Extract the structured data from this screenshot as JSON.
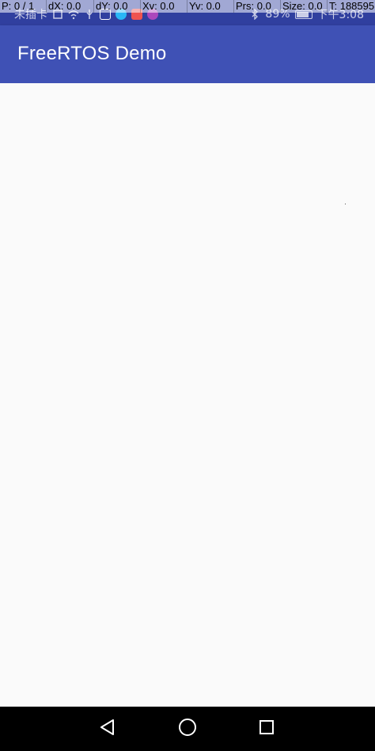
{
  "pointer_overlay": {
    "p": "P: 0 / 1",
    "dx": "dX: 0.0",
    "dy": "dY: 0.0",
    "xv": "Xv: 0.0",
    "yv": "Yv: 0.0",
    "prs": "Prs: 0.0",
    "size": "Size: 0.0",
    "t": "T: 188595"
  },
  "status_bar": {
    "carrier": "未插卡",
    "battery_percent": "89%",
    "time": "下午3:08",
    "app_icon_colors": [
      "#ffffff",
      "#29b6f6",
      "#ef5350",
      "#ab47bc"
    ]
  },
  "app_bar": {
    "title": "FreeRTOS Demo",
    "color": "#3f51b5"
  },
  "nav_bar": {
    "back_icon": "back-triangle-icon",
    "home_icon": "home-circle-icon",
    "recents_icon": "recents-square-icon"
  }
}
